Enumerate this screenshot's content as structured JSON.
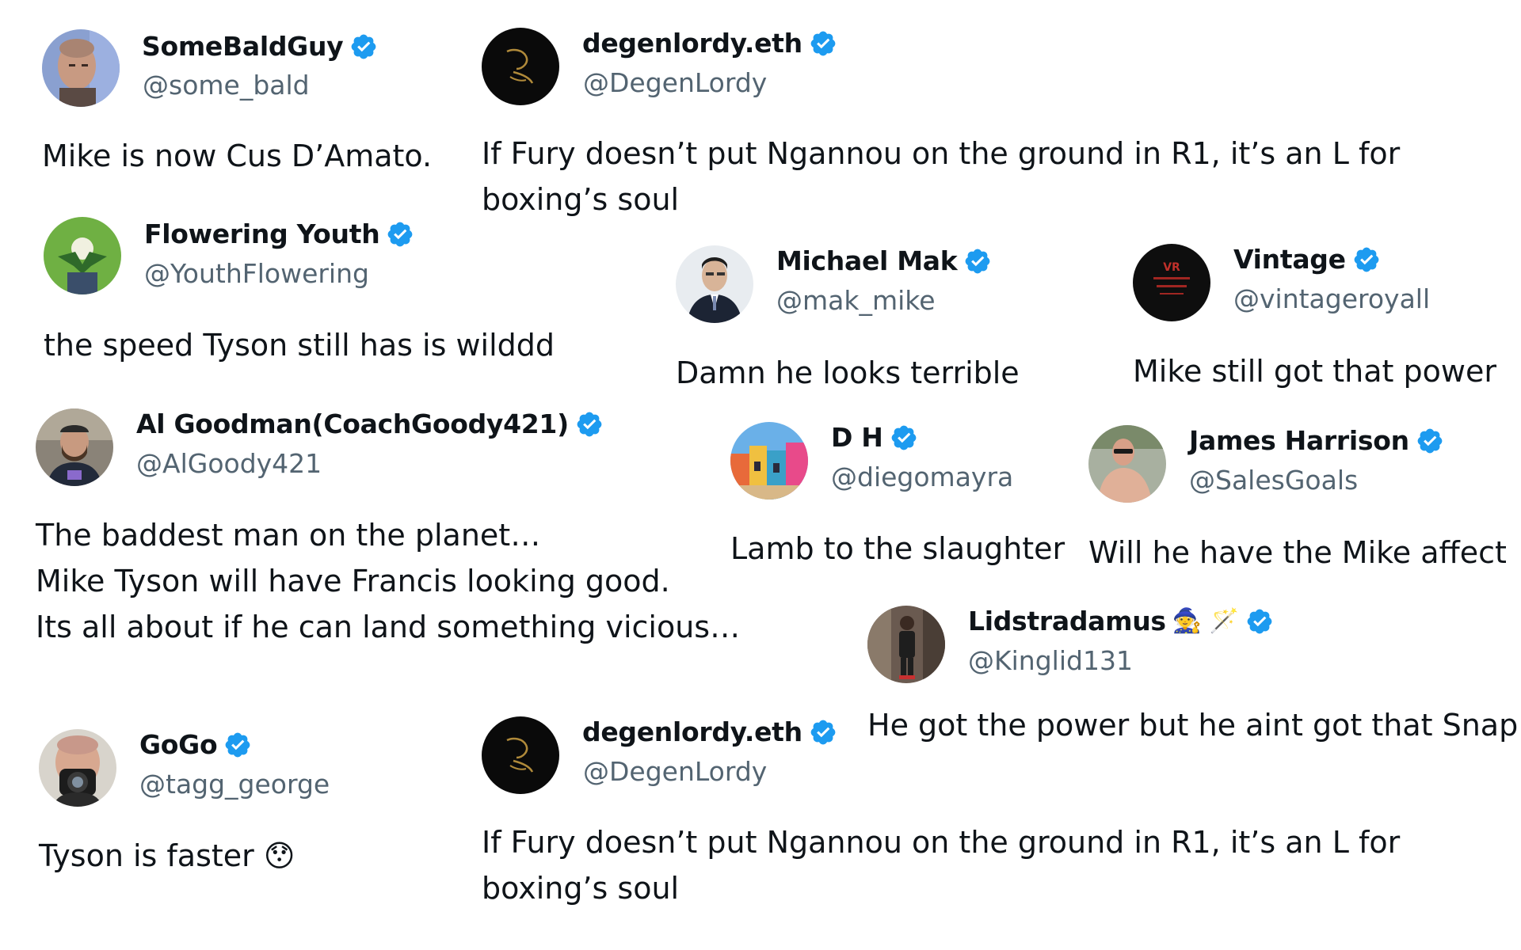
{
  "colors": {
    "verified_badge": "#1d9bf0",
    "name": "#0f1419",
    "handle": "#536471",
    "text": "#0f1419"
  },
  "tweets": [
    {
      "name": "SomeBaldGuy",
      "handle": "@some_bald",
      "text": "Mike is now Cus D’Amato.",
      "avatar_icon": "bald-man-avatar"
    },
    {
      "name": "degenlordy.eth",
      "handle": "@DegenLordy",
      "text": "If Fury doesn’t put Ngannou on the ground in R1, it’s an L for boxing’s soul",
      "avatar_icon": "degen-lordy-logo-avatar"
    },
    {
      "name": "Flowering Youth",
      "handle": "@YouthFlowering",
      "text": "the speed Tyson still has is wilddd",
      "avatar_icon": "yoda-flower-avatar"
    },
    {
      "name": "Michael Mak",
      "handle": "@mak_mike",
      "text": "Damn he looks terrible",
      "avatar_icon": "man-in-suit-avatar"
    },
    {
      "name": "Vintage",
      "handle": "@vintageroyall",
      "text": "Mike still got that power",
      "avatar_icon": "vintage-royal-logo-avatar",
      "avatar_text": "VR"
    },
    {
      "name": "Al Goodman(CoachGoody421)",
      "handle": "@AlGoody421",
      "text": "The baddest man on the planet…\nMike Tyson will have Francis looking good.\nIts all about if he can land something vicious…",
      "avatar_icon": "bearded-man-avatar"
    },
    {
      "name": "D H",
      "handle": "@diegomayra",
      "text": "Lamb to the slaughter",
      "avatar_icon": "colorful-street-avatar"
    },
    {
      "name": "James Harrison",
      "handle": "@SalesGoals",
      "text": "Will he have the Mike affect",
      "avatar_icon": "shirtless-man-avatar"
    },
    {
      "name": "Lidstradamus",
      "emoji": "🧙 🪄",
      "handle": "@Kinglid131",
      "text": "He got the power but he aint got that Snap!!",
      "avatar_icon": "person-standing-avatar"
    },
    {
      "name": "GoGo",
      "handle": "@tagg_george",
      "text": "Tyson is faster 😯",
      "avatar_icon": "man-with-camera-avatar"
    },
    {
      "name": "degenlordy.eth",
      "handle": "@DegenLordy",
      "text": "If Fury doesn’t put Ngannou on the ground in R1, it’s an L for boxing’s soul",
      "avatar_icon": "degen-lordy-logo-avatar"
    }
  ]
}
